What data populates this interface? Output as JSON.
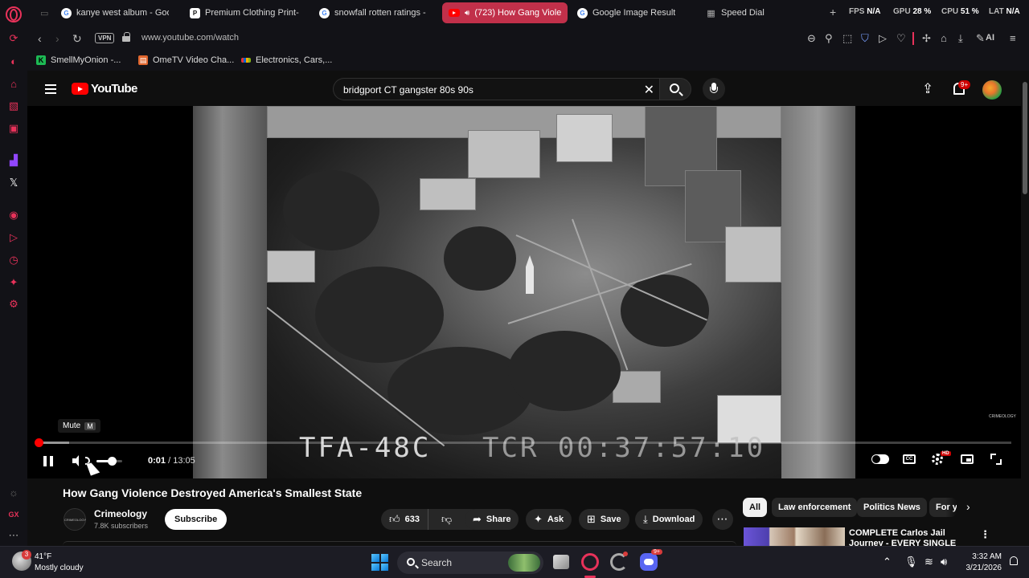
{
  "browser": {
    "tabs": [
      {
        "label": "kanye west album - Goog",
        "favicon": "google-icon"
      },
      {
        "label": "Premium Clothing Print-on",
        "favicon": "printful-icon"
      },
      {
        "label": "snowfall rotten ratings - G",
        "favicon": "google-icon"
      },
      {
        "label": "(723) How Gang Viole",
        "favicon": "youtube-icon",
        "active": true
      },
      {
        "label": "Google Image Result",
        "favicon": "google-icon"
      },
      {
        "label": "Speed Dial",
        "favicon": "grid-icon"
      }
    ],
    "perf": {
      "fps_label": "FPS",
      "fps_value": "N/A",
      "gpu_label": "GPU",
      "gpu_value": "28 %",
      "cpu_label": "CPU",
      "cpu_value": "51 %",
      "lat_label": "LAT",
      "lat_value": "N/A"
    },
    "vpn_label": "VPN",
    "url": "www.youtube.com/watch",
    "ai_label": "AI",
    "bookmarks": [
      {
        "label": "SmellMyOnion -..."
      },
      {
        "label": "OmeTV Video Cha..."
      },
      {
        "label": "Electronics, Cars,..."
      }
    ],
    "sidebar_gx_label": "GX",
    "accent_color": "#e8325a"
  },
  "youtube": {
    "logo_text": "YouTube",
    "search_query": "bridgport CT gangster 80s 90s",
    "notifications_badge": "9+",
    "player": {
      "overlay_left": "TFA-48C",
      "overlay_right": "TCR 00:37:57:10",
      "mute_tooltip": "Mute",
      "mute_key": "M",
      "current_time": "0:01",
      "separator": "/",
      "duration": "13:05",
      "progress_fraction": 0.0013,
      "volume_fraction": 0.6,
      "quality_badge": "HD",
      "cc_label": "CC",
      "watermark_text": "CRIMEOLOGY"
    },
    "video": {
      "title": "How Gang Violence Destroyed America's Smallest State",
      "channel_name": "Crimeology",
      "channel_avatar_text": "CRIMEOLOGY",
      "subscribers": "7.8K subscribers",
      "subscribe_label": "Subscribe",
      "like_count": "633",
      "share_label": "Share",
      "ask_label": "Ask",
      "save_label": "Save",
      "download_label": "Download"
    },
    "chips": [
      {
        "label": "All",
        "selected": true
      },
      {
        "label": "Law enforcement"
      },
      {
        "label": "Politics News"
      },
      {
        "label": "For y"
      }
    ],
    "recommendation": {
      "title": "COMPLETE Carlos Jail Journey - EVERY SINGLE SCENE - Par"
    }
  },
  "taskbar": {
    "weather_temp": "41°F",
    "weather_desc": "Mostly cloudy",
    "weather_badge": "3",
    "search_label": "Search",
    "discord_badge": "9+",
    "time": "3:32 AM",
    "date": "3/21/2026"
  }
}
